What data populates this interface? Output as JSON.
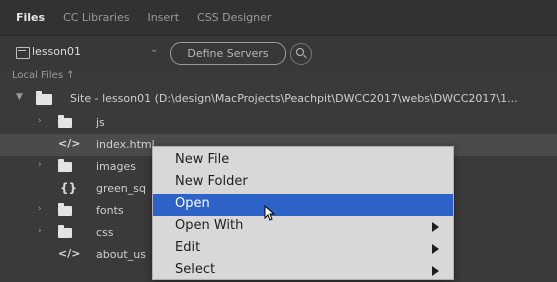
{
  "tabs": [
    "Files",
    "CC Libraries",
    "Insert",
    "CSS Designer"
  ],
  "toolbar": {
    "site_name": "lesson01",
    "define_servers": "Define Servers"
  },
  "local_files_label": "Local Files ↑",
  "tree": {
    "site": "Site - lesson01 (D:\\design\\MacProjects\\Peachpit\\DWCC2017\\webs\\DWCC2017\\1...",
    "rows": [
      "js",
      "index.html",
      "images",
      "green_sq",
      "fonts",
      "css",
      "about_us"
    ]
  },
  "context_menu": {
    "items": [
      {
        "label": "New File",
        "submenu": false
      },
      {
        "label": "New Folder",
        "submenu": false
      },
      {
        "label": "Open",
        "submenu": false
      },
      {
        "label": "Open With",
        "submenu": true
      },
      {
        "label": "Edit",
        "submenu": true
      },
      {
        "label": "Select",
        "submenu": true
      }
    ],
    "highlighted": "Open"
  },
  "colors": {
    "panel_bg": "#3a3a3a",
    "menu_bg": "#d8d8d8",
    "highlight": "#2d63c8"
  }
}
